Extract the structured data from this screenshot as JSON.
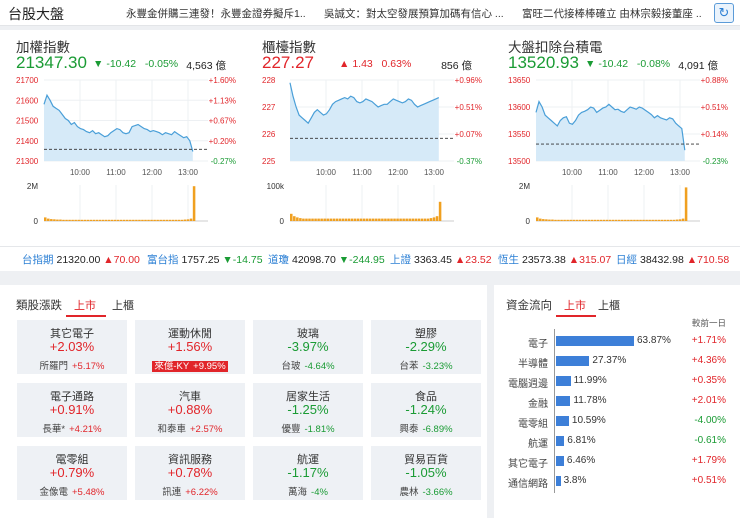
{
  "header": {
    "title": "台股大盤",
    "news": [
      "永豐金併購三連發！永豐金證券擬斥1...",
      "吳誠文：對太空發展預算加碼有信心 ...",
      "富旺二代接棒棒確立 由林宗毅接董座 ..."
    ]
  },
  "indices": [
    {
      "name": "加權指數",
      "value": "21347.30",
      "change": "-10.42",
      "pct": "-0.05%",
      "volume": "4,563 億",
      "direction": "down",
      "price_ticks": [
        "21700",
        "21600",
        "21500",
        "21400",
        "21300"
      ],
      "pct_ticks": [
        "+1.60%",
        "+1.13%",
        "+0.67%",
        "+0.20%",
        "-0.27%"
      ],
      "vol_ticks": [
        "2M",
        "0"
      ],
      "time_ticks": [
        "10:00",
        "11:00",
        "12:00",
        "13:00"
      ],
      "prev_close": 21357.72,
      "ymin": 21300,
      "ymax": 21700,
      "vmax": 2000000,
      "series": [
        21580,
        21625,
        21600,
        21570,
        21560,
        21550,
        21530,
        21510,
        21500,
        21480,
        21490,
        21470,
        21460,
        21455,
        21445,
        21440,
        21450,
        21435,
        21440,
        21430,
        21420,
        21425,
        21440,
        21450,
        21460,
        21455,
        21440,
        21435,
        21440,
        21470,
        21475,
        21480,
        21470,
        21460,
        21455,
        21445,
        21450,
        21445,
        21440,
        21430,
        21440,
        21435,
        21430,
        21445,
        21435,
        21425,
        21415,
        21420,
        21400,
        21347
      ],
      "volumes": [
        0.15,
        0.1,
        0.08,
        0.07,
        0.06,
        0.06,
        0.05,
        0.05,
        0.05,
        0.05,
        0.05,
        0.05,
        0.05,
        0.05,
        0.05,
        0.05,
        0.05,
        0.05,
        0.05,
        0.05,
        0.05,
        0.05,
        0.05,
        0.05,
        0.05,
        0.05,
        0.05,
        0.05,
        0.05,
        0.05,
        0.05,
        0.05,
        0.05,
        0.05,
        0.05,
        0.05,
        0.05,
        0.05,
        0.05,
        0.05,
        0.05,
        0.05,
        0.05,
        0.05,
        0.05,
        0.05,
        0.06,
        0.07,
        0.1,
        1.45
      ]
    },
    {
      "name": "櫃檯指數",
      "value": "227.27",
      "change": "1.43",
      "pct": "0.63%",
      "volume": "856 億",
      "direction": "up",
      "price_ticks": [
        "228",
        "227",
        "226",
        "225"
      ],
      "pct_ticks": [
        "+0.96%",
        "+0.51%",
        "+0.07%",
        "-0.37%"
      ],
      "vol_ticks": [
        "100k",
        "0"
      ],
      "time_ticks": [
        "10:00",
        "11:00",
        "12:00",
        "13:00"
      ],
      "prev_close": 225.84,
      "ymin": 225,
      "ymax": 228,
      "vmax": 100000,
      "series": [
        227.9,
        227.4,
        227.0,
        226.7,
        226.6,
        226.5,
        226.4,
        226.6,
        226.8,
        226.9,
        226.8,
        226.7,
        226.75,
        226.9,
        227.1,
        227.2,
        227.25,
        227.3,
        227.35,
        227.3,
        227.4,
        227.35,
        227.2,
        227.15,
        227.2,
        227.3,
        227.25,
        227.2,
        227.1,
        227.0,
        227.05,
        227.1,
        227.1,
        227.2,
        227.3,
        227.25,
        227.2,
        227.15,
        227.2,
        227.3,
        227.25,
        227.1,
        227.0,
        227.05,
        227.1,
        227.15,
        227.2,
        227.25,
        227.3,
        227.35
      ],
      "volumes": [
        0.3,
        0.2,
        0.15,
        0.12,
        0.1,
        0.1,
        0.1,
        0.1,
        0.1,
        0.1,
        0.1,
        0.1,
        0.1,
        0.1,
        0.1,
        0.1,
        0.1,
        0.1,
        0.1,
        0.1,
        0.1,
        0.1,
        0.1,
        0.1,
        0.1,
        0.1,
        0.1,
        0.1,
        0.1,
        0.1,
        0.1,
        0.1,
        0.1,
        0.1,
        0.1,
        0.1,
        0.1,
        0.1,
        0.1,
        0.1,
        0.1,
        0.1,
        0.1,
        0.1,
        0.1,
        0.1,
        0.12,
        0.15,
        0.2,
        0.8
      ]
    },
    {
      "name": "大盤扣除台積電",
      "value": "13520.93",
      "change": "-10.42",
      "pct": "-0.08%",
      "volume": "4,091 億",
      "direction": "down",
      "price_ticks": [
        "13650",
        "13600",
        "13550",
        "13500"
      ],
      "pct_ticks": [
        "+0.88%",
        "+0.51%",
        "+0.14%",
        "-0.23%"
      ],
      "vol_ticks": [
        "2M",
        "0"
      ],
      "time_ticks": [
        "10:00",
        "11:00",
        "12:00",
        "13:00"
      ],
      "prev_close": 13531.35,
      "ymin": 13500,
      "ymax": 13650,
      "vmax": 2000000,
      "series": [
        13590,
        13610,
        13600,
        13585,
        13580,
        13575,
        13570,
        13565,
        13575,
        13580,
        13582,
        13570,
        13568,
        13575,
        13585,
        13590,
        13592,
        13595,
        13600,
        13598,
        13590,
        13594,
        13598,
        13600,
        13605,
        13600,
        13595,
        13596,
        13592,
        13590,
        13595,
        13600,
        13598,
        13596,
        13600,
        13598,
        13594,
        13590,
        13586,
        13580,
        13584,
        13580,
        13578,
        13576,
        13580,
        13578,
        13570,
        13565,
        13560,
        13520
      ],
      "volumes": [
        0.15,
        0.1,
        0.08,
        0.07,
        0.06,
        0.06,
        0.05,
        0.05,
        0.05,
        0.05,
        0.05,
        0.05,
        0.05,
        0.05,
        0.05,
        0.05,
        0.05,
        0.05,
        0.05,
        0.05,
        0.05,
        0.05,
        0.05,
        0.05,
        0.05,
        0.05,
        0.05,
        0.05,
        0.05,
        0.05,
        0.05,
        0.05,
        0.05,
        0.05,
        0.05,
        0.05,
        0.05,
        0.05,
        0.05,
        0.05,
        0.05,
        0.05,
        0.05,
        0.05,
        0.05,
        0.05,
        0.06,
        0.07,
        0.1,
        1.4
      ]
    }
  ],
  "tickers": [
    {
      "name": "台指期",
      "value": "21320.00",
      "change": "▲70.00",
      "direction": "up"
    },
    {
      "name": "富台指",
      "value": "1757.25",
      "change": "▼-14.75",
      "direction": "down"
    },
    {
      "name": "道瓊",
      "value": "42098.70",
      "change": "▼-244.95",
      "direction": "down"
    },
    {
      "name": "上證",
      "value": "3363.45",
      "change": "▲23.52",
      "direction": "up"
    },
    {
      "name": "恆生",
      "value": "23573.38",
      "change": "▲315.07",
      "direction": "up"
    },
    {
      "name": "日經",
      "value": "38432.98",
      "change": "▲710.58",
      "direction": "up"
    }
  ],
  "sectors": {
    "title": "類股漲跌",
    "tabs": [
      "上市",
      "上櫃"
    ],
    "active_tab": "上市",
    "items": [
      {
        "name": "其它電子",
        "pct": "+2.03%",
        "stock": "所羅門",
        "stock_pct": "+5.17%",
        "direction": "up",
        "highlight": false
      },
      {
        "name": "運動休閒",
        "pct": "+1.56%",
        "stock": "來億-KY",
        "stock_pct": "+9.95%",
        "direction": "up",
        "highlight": true
      },
      {
        "name": "玻璃",
        "pct": "-3.97%",
        "stock": "台玻",
        "stock_pct": "-4.64%",
        "direction": "down",
        "highlight": false
      },
      {
        "name": "塑膠",
        "pct": "-2.29%",
        "stock": "台苯",
        "stock_pct": "-3.23%",
        "direction": "down",
        "highlight": false
      },
      {
        "name": "電子通路",
        "pct": "+0.91%",
        "stock": "長華*",
        "stock_pct": "+4.21%",
        "direction": "up",
        "highlight": false
      },
      {
        "name": "汽車",
        "pct": "+0.88%",
        "stock": "和泰車",
        "stock_pct": "+2.57%",
        "direction": "up",
        "highlight": false
      },
      {
        "name": "居家生活",
        "pct": "-1.25%",
        "stock": "優豐",
        "stock_pct": "-1.81%",
        "direction": "down",
        "highlight": false
      },
      {
        "name": "食品",
        "pct": "-1.24%",
        "stock": "興泰",
        "stock_pct": "-6.89%",
        "direction": "down",
        "highlight": false
      },
      {
        "name": "電零組",
        "pct": "+0.79%",
        "stock": "金像電",
        "stock_pct": "+5.48%",
        "direction": "up",
        "highlight": false
      },
      {
        "name": "資訊服務",
        "pct": "+0.78%",
        "stock": "訊連",
        "stock_pct": "+6.22%",
        "direction": "up",
        "highlight": false
      },
      {
        "name": "航運",
        "pct": "-1.17%",
        "stock": "萬海",
        "stock_pct": "-4%",
        "direction": "down",
        "highlight": false
      },
      {
        "name": "貿易百貨",
        "pct": "-1.05%",
        "stock": "農林",
        "stock_pct": "-3.66%",
        "direction": "down",
        "highlight": false
      }
    ]
  },
  "fund_flow": {
    "title": "資金流向",
    "tabs": [
      "上市",
      "上櫃"
    ],
    "active_tab": "上市",
    "column_header": "較前一日",
    "items": [
      {
        "name": "電子",
        "share": 63.87,
        "share_label": "63.87%",
        "change": "+1.71%",
        "direction": "up"
      },
      {
        "name": "半導體",
        "share": 27.37,
        "share_label": "27.37%",
        "change": "+4.36%",
        "direction": "up"
      },
      {
        "name": "電腦週邊",
        "share": 11.99,
        "share_label": "11.99%",
        "change": "+0.35%",
        "direction": "up"
      },
      {
        "name": "金融",
        "share": 11.78,
        "share_label": "11.78%",
        "change": "+2.01%",
        "direction": "up"
      },
      {
        "name": "電零組",
        "share": 10.59,
        "share_label": "10.59%",
        "change": "-4.00%",
        "direction": "down"
      },
      {
        "name": "航運",
        "share": 6.81,
        "share_label": "6.81%",
        "change": "-0.61%",
        "direction": "down"
      },
      {
        "name": "其它電子",
        "share": 6.46,
        "share_label": "6.46%",
        "change": "+1.79%",
        "direction": "up"
      },
      {
        "name": "通信網路",
        "share": 3.8,
        "share_label": "3.8%",
        "change": "+0.51%",
        "direction": "up"
      }
    ]
  },
  "colors": {
    "up": "#e1252a",
    "down": "#1a9b34",
    "line": "#4a9fd8",
    "area": "#d6eaf8",
    "volume": "#f0a020",
    "bar": "#3d7fd8"
  }
}
